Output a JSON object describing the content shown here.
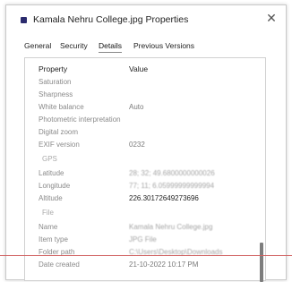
{
  "window": {
    "title": "Kamala Nehru College.jpg Properties",
    "close_label": "✕"
  },
  "tabs": [
    "General",
    "Security",
    "Details",
    "Previous Versions"
  ],
  "active_tab": "Details",
  "table": {
    "headers": {
      "property": "Property",
      "value": "Value"
    },
    "rows": [
      {
        "property": "Saturation",
        "value": ""
      },
      {
        "property": "Sharpness",
        "value": ""
      },
      {
        "property": "White balance",
        "value": "Auto"
      },
      {
        "property": "Photometric interpretation",
        "value": ""
      },
      {
        "property": "Digital zoom",
        "value": ""
      },
      {
        "property": "EXIF version",
        "value": "0232"
      },
      {
        "property": "GPS",
        "value": ""
      },
      {
        "property": "Latitude",
        "value": "28; 32; 49.6800000000026"
      },
      {
        "property": "Longitude",
        "value": "77; 11; 6.05999999999994"
      },
      {
        "property": "Altitude",
        "value": "226.30172649273696"
      },
      {
        "property": "File",
        "value": ""
      },
      {
        "property": "Name",
        "value": "Kamala Nehru College.jpg"
      },
      {
        "property": "Item type",
        "value": "JPG File"
      },
      {
        "property": "Folder path",
        "value": "C:\\Users\\Desktop\\Downloads"
      },
      {
        "property": "Date created",
        "value": "21-10-2022 10:17 PM"
      }
    ]
  }
}
